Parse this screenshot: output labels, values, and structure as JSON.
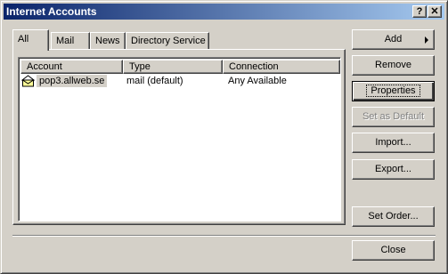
{
  "window": {
    "title": "Internet Accounts",
    "help_label": "?",
    "close_label": "✕"
  },
  "tabs": [
    "All",
    "Mail",
    "News",
    "Directory Service"
  ],
  "columns": [
    "Account",
    "Type",
    "Connection"
  ],
  "accounts": [
    {
      "account": "pop3.allweb.se",
      "type": "mail (default)",
      "connection": "Any Available",
      "icon": "mail-account-icon"
    }
  ],
  "buttons": {
    "add": "Add",
    "remove": "Remove",
    "properties": "Properties",
    "set_default": "Set as Default",
    "import": "Import...",
    "export": "Export...",
    "set_order": "Set Order...",
    "close": "Close"
  }
}
